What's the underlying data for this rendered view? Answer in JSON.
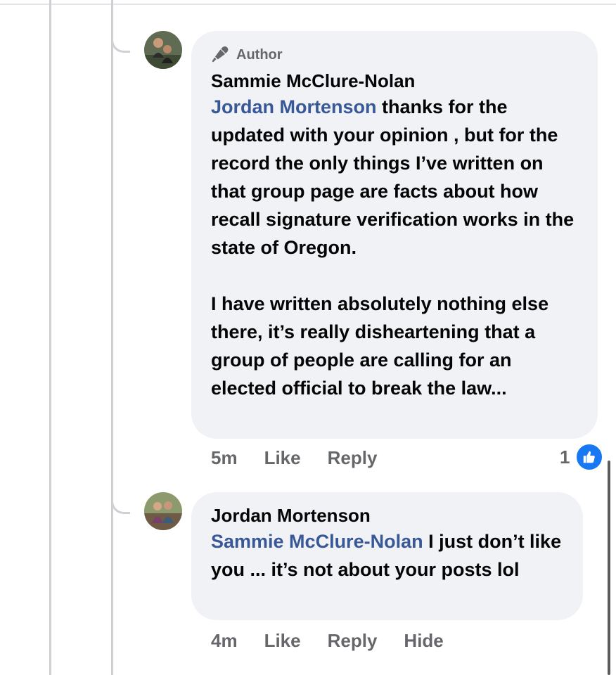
{
  "comments": [
    {
      "badge_label": "Author",
      "author": "Sammie McClure-Nolan",
      "mention": "Jordan Mortenson",
      "text": " thanks for the updated with your opinion , but for the record the only things I’ve written on that group page are facts about how recall signature verification works in the state of Oregon.\n\nI have written absolutely nothing else there, it’s really disheartening that a group of people are calling for an elected official to break the law...",
      "time": "5m",
      "like_label": "Like",
      "reply_label": "Reply",
      "reaction_count": "1",
      "reaction_icon": "thumbs-up-icon"
    },
    {
      "author": "Jordan Mortenson",
      "mention": "Sammie McClure-Nolan",
      "text": " I just don’t like you ... it’s not about your posts lol",
      "time": "4m",
      "like_label": "Like",
      "reply_label": "Reply",
      "hide_label": "Hide"
    }
  ],
  "colors": {
    "bubble": "#f0f2f5",
    "mention": "#385898",
    "secondary_text": "#65676b",
    "like_blue": "#1877f2"
  }
}
